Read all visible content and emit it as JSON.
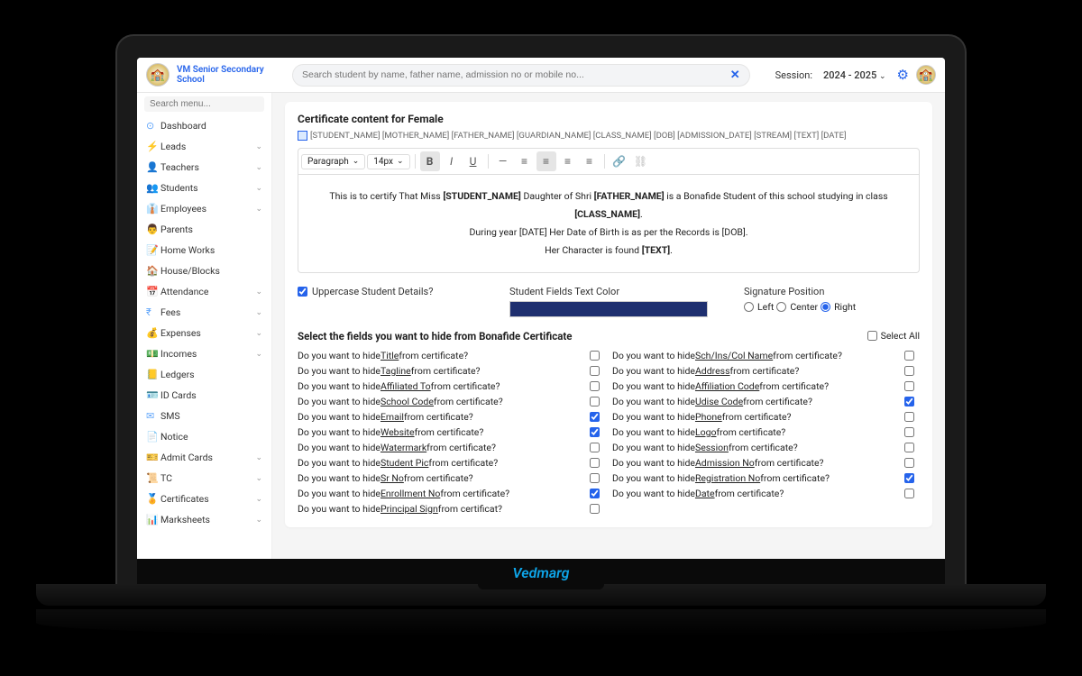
{
  "header": {
    "school_name": "VM Senior Secondary School",
    "search_placeholder": "Search student by name, father name, admission no or mobile no...",
    "session_label": "Session:",
    "session_value": "2024 - 2025"
  },
  "sidebar": {
    "search_placeholder": "Search menu...",
    "items": [
      {
        "icon": "⊙",
        "label": "Dashboard",
        "expandable": false
      },
      {
        "icon": "⚡",
        "label": "Leads",
        "expandable": true
      },
      {
        "icon": "👤",
        "label": "Teachers",
        "expandable": true
      },
      {
        "icon": "👥",
        "label": "Students",
        "expandable": true
      },
      {
        "icon": "👔",
        "label": "Employees",
        "expandable": true
      },
      {
        "icon": "👨",
        "label": "Parents",
        "expandable": false
      },
      {
        "icon": "📝",
        "label": "Home Works",
        "expandable": false
      },
      {
        "icon": "🏠",
        "label": "House/Blocks",
        "expandable": false
      },
      {
        "icon": "📅",
        "label": "Attendance",
        "expandable": true
      },
      {
        "icon": "₹",
        "label": "Fees",
        "expandable": true
      },
      {
        "icon": "💰",
        "label": "Expenses",
        "expandable": true
      },
      {
        "icon": "💵",
        "label": "Incomes",
        "expandable": true
      },
      {
        "icon": "📒",
        "label": "Ledgers",
        "expandable": false
      },
      {
        "icon": "🪪",
        "label": "ID Cards",
        "expandable": false
      },
      {
        "icon": "✉",
        "label": "SMS",
        "expandable": false
      },
      {
        "icon": "📄",
        "label": "Notice",
        "expandable": false
      },
      {
        "icon": "🎫",
        "label": "Admit Cards",
        "expandable": true
      },
      {
        "icon": "📜",
        "label": "TC",
        "expandable": true
      },
      {
        "icon": "🏅",
        "label": "Certificates",
        "expandable": true
      },
      {
        "icon": "📊",
        "label": "Marksheets",
        "expandable": true
      }
    ]
  },
  "main": {
    "title": "Certificate content for Female",
    "tags": "[STUDENT_NAME] [MOTHER_NAME] [FATHER_NAME] [GUARDIAN_NAME] [CLASS_NAME] [DOB] [ADMISSION_DATE] [STREAM] [TEXT] [DATE]",
    "toolbar": {
      "para": "Paragraph",
      "size": "14px"
    },
    "editor_line1_a": "This is to certify That Miss ",
    "editor_line1_b": "[STUDENT_NAME]",
    "editor_line1_c": " Daughter of Shri ",
    "editor_line1_d": "[FATHER_NAME]",
    "editor_line1_e": " is a Bonafide Student of this school studying in class ",
    "editor_line1_f": "[CLASS_NAME]",
    "editor_line1_g": ".",
    "editor_line2": "During year [DATE] Her Date of Birth is as per the Records is [DOB].",
    "editor_line3_a": "Her Character is found ",
    "editor_line3_b": "[TEXT]",
    "editor_line3_c": ".",
    "uppercase_label": "Uppercase Student Details?",
    "color_label": "Student Fields Text Color",
    "color_value": "#1e2f6f",
    "sig_label": "Signature Position",
    "sig_left": "Left",
    "sig_center": "Center",
    "sig_right": "Right",
    "hide_title": "Select the fields you want to hide from Bonafide Certificate",
    "select_all": "Select All",
    "hide_prefix": "Do you want to hide ",
    "hide_suffix": " from certificate?",
    "hide_suffix_short": " from certificat?",
    "fields": {
      "title": "Title",
      "sch": "Sch/Ins/Col Name",
      "tagline": "Tagline",
      "address": "Address",
      "affto": "Affiliated To",
      "affcode": "Affiliation Code",
      "schcode": "School Code",
      "udise": "Udise Code",
      "email": "Email",
      "phone": "Phone",
      "website": "Website",
      "logo": "Logo",
      "watermark": "Watermark",
      "session": "Session",
      "studpic": "Student Pic",
      "admno": "Admission No",
      "srno": "Sr No",
      "regno": "Registration No",
      "enroll": "Enrollment No",
      "date": "Date",
      "psign": "Principal Sign"
    }
  },
  "brand": "Vedmarg"
}
